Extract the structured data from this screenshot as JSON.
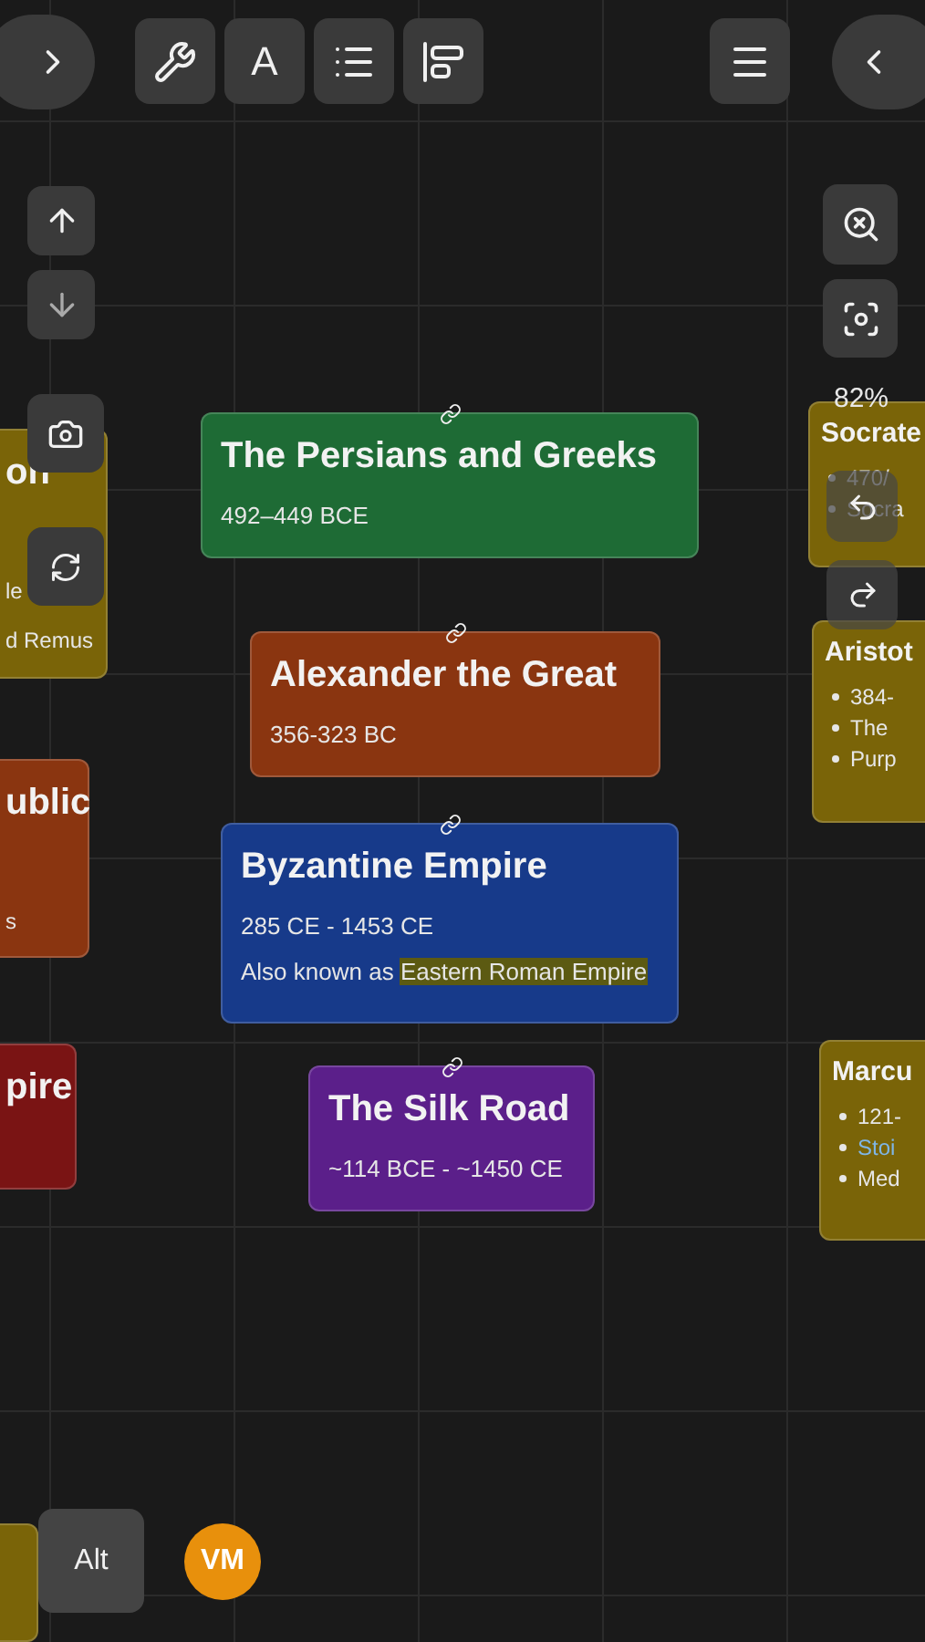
{
  "toolbar": {
    "text_tool_label": "A"
  },
  "zoom": {
    "reading": "82%"
  },
  "nodes": [
    {
      "title": "on",
      "color": "#7a6408",
      "lines": [
        {
          "kind": "text",
          "text": "le",
          "link": false
        },
        {
          "kind": "text",
          "text": "d Remus",
          "link": false
        }
      ]
    },
    {
      "title": "ublic",
      "color": "#8a3510",
      "linked": false,
      "lines": [
        {
          "kind": "text",
          "text": "s",
          "link": false
        }
      ]
    },
    {
      "title": "pire",
      "color": "#7a1414",
      "linked": false
    },
    {
      "title": "The Persians and Greeks",
      "color": "#1e6b35",
      "linked": true,
      "lines": [
        {
          "kind": "text",
          "text": "492–449 BCE",
          "link": false
        }
      ]
    },
    {
      "title": "Alexander the Great",
      "color": "#8a3510",
      "linked": true,
      "lines": [
        {
          "kind": "text",
          "text": "356-323 BC",
          "link": false
        }
      ]
    },
    {
      "title": "Byzantine Empire",
      "color": "#173a8a",
      "linked": true,
      "lines": [
        {
          "kind": "text",
          "text": "285 CE - 1453 CE",
          "link": false
        },
        {
          "kind": "text",
          "text": "Also known as ",
          "highlight": "Eastern Roman Empire",
          "link": false
        }
      ]
    },
    {
      "title": "The Silk Road",
      "color": "#5b1f8a",
      "linked": true,
      "lines": [
        {
          "kind": "text",
          "text": "~114 BCE - ~1450 CE",
          "link": false
        }
      ]
    },
    {
      "title": "Socrate",
      "color": "#7a6408",
      "linked": false,
      "lines": [
        {
          "kind": "bullet",
          "text": "470/",
          "link": false
        },
        {
          "kind": "bullet",
          "text": "Socra",
          "link": false
        }
      ]
    },
    {
      "title": "Aristot",
      "color": "#7a6408",
      "linked": false,
      "lines": [
        {
          "kind": "bullet",
          "text": "384-",
          "link": false
        },
        {
          "kind": "bullet",
          "text": "The",
          "link": false
        },
        {
          "kind": "bullet",
          "text": "Purp",
          "link": false
        }
      ]
    },
    {
      "title": "Marcu",
      "color": "#7a6408",
      "linked": false,
      "lines": [
        {
          "kind": "bullet",
          "text": "121-",
          "link": false
        },
        {
          "kind": "bullet",
          "text": "Stoi",
          "link": true
        },
        {
          "kind": "bullet",
          "text": "Med",
          "link": false
        }
      ]
    },
    {
      "color": "#7a6408",
      "linked": false
    }
  ],
  "modifier_key": {
    "label": "Alt"
  },
  "user": {
    "initials": "VM"
  }
}
